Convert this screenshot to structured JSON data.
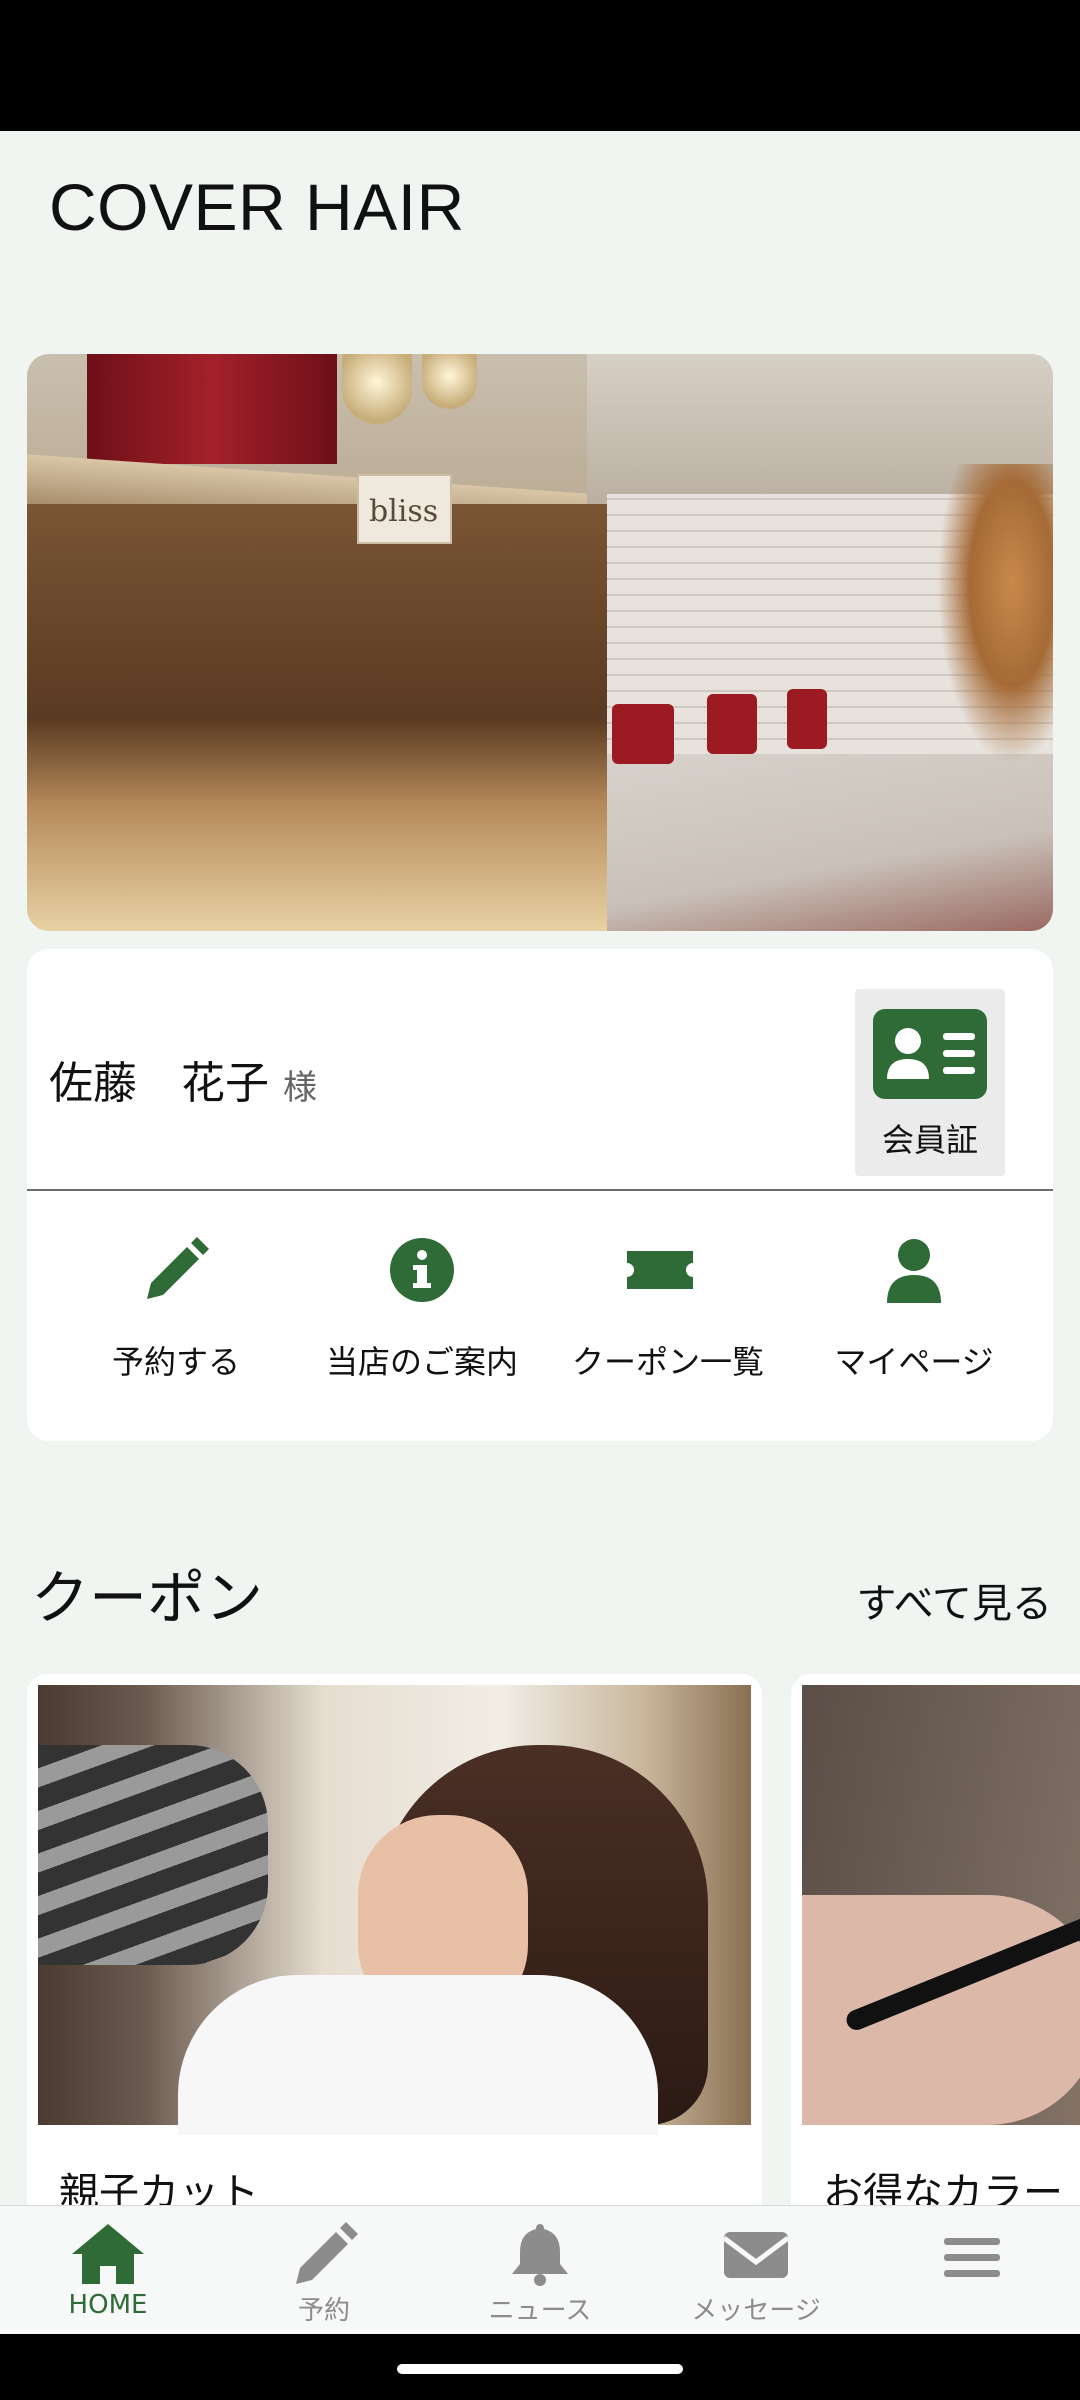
{
  "app": {
    "title": "COVER HAIR"
  },
  "hero": {
    "alt": "salon interior",
    "sign_text": "bliss"
  },
  "member": {
    "name": "佐藤　花子",
    "suffix": "様",
    "card_button_label": "会員証"
  },
  "quick_actions": [
    {
      "label": "予約する",
      "icon": "pencil-icon"
    },
    {
      "label": "当店のご案内",
      "icon": "info-icon"
    },
    {
      "label": "クーポン一覧",
      "icon": "ticket-icon"
    },
    {
      "label": "マイページ",
      "icon": "person-icon"
    }
  ],
  "coupons": {
    "section_title": "クーポン",
    "see_all_label": "すべて見る",
    "items": [
      {
        "title": "親子カット"
      },
      {
        "title": "お得なカラー"
      }
    ]
  },
  "bottom_nav": {
    "items": [
      {
        "label": "HOME",
        "icon": "home-icon",
        "active": true
      },
      {
        "label": "予約",
        "icon": "pencil-icon",
        "active": false
      },
      {
        "label": "ニュース",
        "icon": "bell-icon",
        "active": false
      },
      {
        "label": "メッセージ",
        "icon": "envelope-icon",
        "active": false
      },
      {
        "label": "",
        "icon": "menu-icon",
        "active": false
      }
    ]
  },
  "colors": {
    "accent": "#2e6b36",
    "background": "#f0f5f2",
    "inactive": "#8c8c8c"
  }
}
